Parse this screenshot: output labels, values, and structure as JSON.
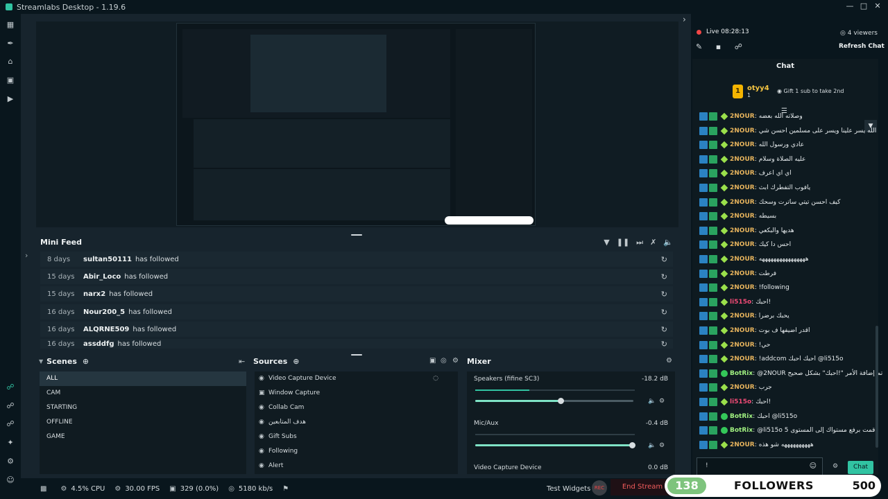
{
  "window": {
    "title": "Streamlabs Desktop - 1.19.6"
  },
  "minifeed": {
    "title": "Mini Feed",
    "rows": [
      {
        "age": "8 days",
        "user": "sultan50111",
        "action": "has followed"
      },
      {
        "age": "15 days",
        "user": "Abir_Loco",
        "action": "has followed"
      },
      {
        "age": "15 days",
        "user": "narx2",
        "action": "has followed"
      },
      {
        "age": "16 days",
        "user": "Nour200_5",
        "action": "has followed"
      },
      {
        "age": "16 days",
        "user": "ALQRNE509",
        "action": "has followed"
      },
      {
        "age": "16 days",
        "user": "assddfg",
        "action": "has followed"
      }
    ]
  },
  "scenes": {
    "title": "Scenes",
    "items": [
      "ALL",
      "CAM",
      "STARTING",
      "OFFLINE",
      "GAME"
    ],
    "selected": "ALL"
  },
  "sources": {
    "title": "Sources",
    "items": [
      "Video Capture Device",
      "Window Capture",
      "Collab Cam",
      "هدف المتابعين",
      "Gift Subs",
      "Following",
      "Alert"
    ]
  },
  "mixer": {
    "title": "Mixer",
    "channels": [
      {
        "name": "Speakers (fifine SC3)",
        "db": "-18.2 dB",
        "level": 0.34,
        "volume": 0.54
      },
      {
        "name": "Mic/Aux",
        "db": "-0.4 dB",
        "level": 0.0,
        "volume": 0.99
      },
      {
        "name": "Video Capture Device",
        "db": "0.0 dB",
        "level": 0.0,
        "volume": 0.99
      }
    ]
  },
  "footer": {
    "cpu": "4.5% CPU",
    "fps": "30.00 FPS",
    "dropped": "329 (0.0%)",
    "bitrate": "5180 kb/s",
    "test_widgets": "Test Widgets",
    "end_stream": "End Stream",
    "rec_label": "REC"
  },
  "chat": {
    "live_label": "Live 08:28:13",
    "viewers": "4 viewers",
    "refresh": "Refresh Chat",
    "title": "Chat",
    "pinned_user": "otyy4",
    "pinned_count": "1",
    "pinned_badge": "1",
    "gift_text": "Gift 1 sub to take 2nd",
    "send": "Chat",
    "input_value": "!",
    "messages": [
      {
        "nick": "2NOUR",
        "type": "n2",
        "text": "وصلاته الله بعضه"
      },
      {
        "nick": "2NOUR",
        "type": "n2",
        "text": "الله يسر علينا ويسر على مسلمين احسن شي"
      },
      {
        "nick": "2NOUR",
        "type": "n2",
        "text": "عادي ورسول الله"
      },
      {
        "nick": "2NOUR",
        "type": "n2",
        "text": "عليه الصلاة وسلام"
      },
      {
        "nick": "2NOUR",
        "type": "n2",
        "text": "اي اي اعرف"
      },
      {
        "nick": "2NOUR",
        "type": "n2",
        "text": "يافوب التفطرك ابث"
      },
      {
        "nick": "2NOUR",
        "type": "n2",
        "text": "كيف احسن تيتي ساترت وسحك"
      },
      {
        "nick": "2NOUR",
        "type": "n2",
        "text": "بسيطه"
      },
      {
        "nick": "2NOUR",
        "type": "n2",
        "text": "هديها والبكعي"
      },
      {
        "nick": "2NOUR",
        "type": "n2",
        "text": "احس دا كيك"
      },
      {
        "nick": "2NOUR",
        "type": "n2",
        "text": "ههههههههههههههههه"
      },
      {
        "nick": "2NOUR",
        "type": "n2",
        "text": "فرطت"
      },
      {
        "nick": "2NOUR",
        "type": "n2",
        "text": "!following"
      },
      {
        "nick": "li515o",
        "type": "li",
        "text": "احبك!"
      },
      {
        "nick": "2NOUR",
        "type": "n2",
        "text": "يحبك برضرا"
      },
      {
        "nick": "2NOUR",
        "type": "n2",
        "text": "اقدر اضيفها ف بوت"
      },
      {
        "nick": "2NOUR",
        "type": "n2",
        "text": "!حي"
      },
      {
        "nick": "2NOUR",
        "type": "n2",
        "text": "!addcom احبك احبك @li515o"
      },
      {
        "nick": "BotRix",
        "type": "bot",
        "text": "@2NOUR تم إضافة الأمر \"!احبك\" بشكل صحيح"
      },
      {
        "nick": "2NOUR",
        "type": "n2",
        "text": "جرب"
      },
      {
        "nick": "li515o",
        "type": "li",
        "text": "احبك!"
      },
      {
        "nick": "BotRix",
        "type": "bot",
        "text": "احبك @li515o"
      },
      {
        "nick": "BotRix",
        "type": "bot",
        "text": "@li515o قمت برفع مستواك إلى المستوى 5"
      },
      {
        "nick": "2NOUR",
        "type": "n2",
        "text": "ههههههههههه شو هذه"
      }
    ]
  },
  "followers_goal": {
    "current": "138",
    "label": "FOLLOWERS",
    "goal": "500"
  }
}
